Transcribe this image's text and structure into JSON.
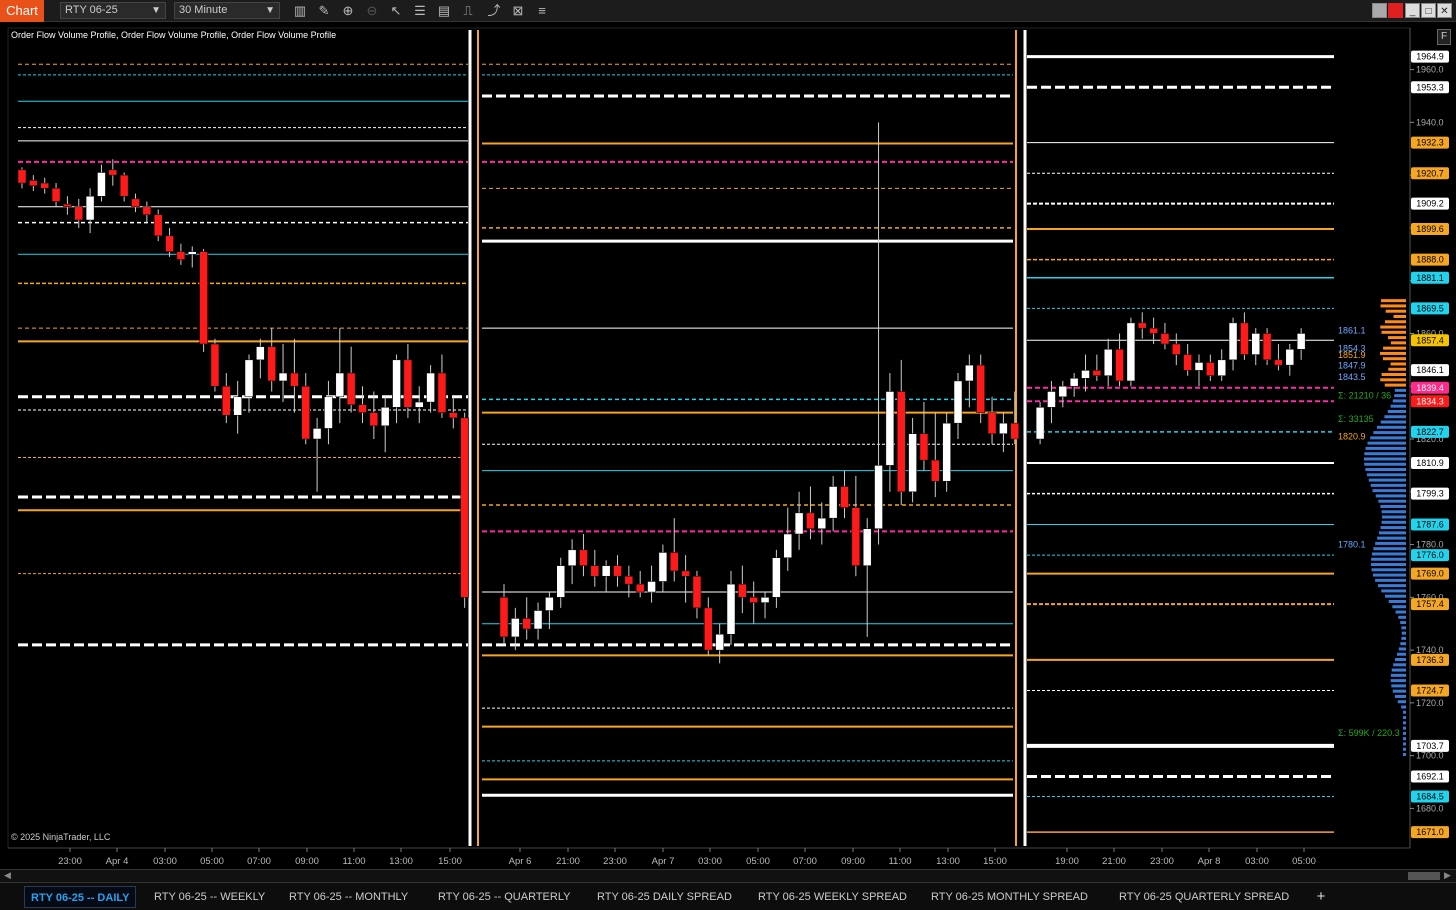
{
  "app": {
    "badge": "Chart",
    "instrument": "RTY 06-25",
    "timeframe": "30 Minute"
  },
  "toolbar_icons": [
    "bar-type-icon",
    "drawing-tool-icon",
    "zoom-in-icon",
    "zoom-out-icon",
    "pointer-icon",
    "properties-icon",
    "data-box-icon",
    "indicators-icon",
    "strategies-icon",
    "template-icon",
    "more-menu-icon"
  ],
  "window_buttons": [
    "link-window-icon",
    "color-link-icon",
    "minimize-icon",
    "maximize-icon",
    "close-icon"
  ],
  "indicator_label": "Order Flow Volume Profile, Order Flow Volume Profile, Order Flow Volume Profile",
  "copyright": "© 2025 NinjaTrader, LLC",
  "f_button": "F",
  "price_axis": {
    "min": 1665,
    "max": 1975,
    "ticks": [
      "1960.0",
      "1940.0",
      "1920.0",
      "1900.0",
      "1880.0",
      "1860.0",
      "1840.0",
      "1820.0",
      "1800.0",
      "1780.0",
      "1760.0",
      "1740.0",
      "1720.0",
      "1700.0",
      "1680.0"
    ],
    "level_labels": [
      {
        "text": "1964.9",
        "value": 1964.9,
        "color": "#ffffff"
      },
      {
        "text": "1953.3",
        "value": 1953.3,
        "color": "#ffffff"
      },
      {
        "text": "1932.3",
        "value": 1932.3,
        "color": "#f5a623"
      },
      {
        "text": "1920.7",
        "value": 1920.7,
        "color": "#f5a623"
      },
      {
        "text": "1909.2",
        "value": 1909.2,
        "color": "#ffffff"
      },
      {
        "text": "1899.6",
        "value": 1899.6,
        "color": "#f5a623"
      },
      {
        "text": "1888.0",
        "value": 1888.0,
        "color": "#f5a623"
      },
      {
        "text": "1881.1",
        "value": 1881.1,
        "color": "#22d3ee"
      },
      {
        "text": "1869.5",
        "value": 1869.5,
        "color": "#22d3ee"
      },
      {
        "text": "1857.4",
        "value": 1857.4,
        "color": "#f5c400"
      },
      {
        "text": "1846.1",
        "value": 1846.1,
        "color": "#ffffff"
      },
      {
        "text": "1839.4",
        "value": 1839.4,
        "color": "#ff2a8a"
      },
      {
        "text": "1834.3",
        "value": 1834.3,
        "color": "#ff1a1a"
      },
      {
        "text": "1822.7",
        "value": 1822.7,
        "color": "#22d3ee"
      },
      {
        "text": "1810.9",
        "value": 1810.9,
        "color": "#ffffff"
      },
      {
        "text": "1799.3",
        "value": 1799.3,
        "color": "#ffffff"
      },
      {
        "text": "1787.6",
        "value": 1787.6,
        "color": "#22d3ee"
      },
      {
        "text": "1776.0",
        "value": 1776.0,
        "color": "#22d3ee"
      },
      {
        "text": "1769.0",
        "value": 1769.0,
        "color": "#f5a623"
      },
      {
        "text": "1757.4",
        "value": 1757.4,
        "color": "#f5a623"
      },
      {
        "text": "1736.3",
        "value": 1736.3,
        "color": "#f5a623"
      },
      {
        "text": "1724.7",
        "value": 1724.7,
        "color": "#f5a623"
      },
      {
        "text": "1703.7",
        "value": 1703.7,
        "color": "#ffffff"
      },
      {
        "text": "1692.1",
        "value": 1692.1,
        "color": "#ffffff"
      },
      {
        "text": "1684.5",
        "value": 1684.5,
        "color": "#22d3ee"
      },
      {
        "text": "1671.0",
        "value": 1671.0,
        "color": "#f5a623"
      }
    ]
  },
  "profile_labels": [
    {
      "text": "1861.1",
      "value": 1861.1,
      "color": "#6fa8ff"
    },
    {
      "text": "1854.3",
      "value": 1854.3,
      "color": "#6fa8ff"
    },
    {
      "text": "1851.9",
      "value": 1851.9,
      "color": "#f5a623"
    },
    {
      "text": "1847.9",
      "value": 1847.9,
      "color": "#6fa8ff"
    },
    {
      "text": "1843.5",
      "value": 1843.5,
      "color": "#6fa8ff"
    },
    {
      "text": "Σ: 21210 / 36",
      "value": 1836.5,
      "color": "#22aa22"
    },
    {
      "text": "Σ: 33135",
      "value": 1827.5,
      "color": "#22aa22"
    },
    {
      "text": "1820.9",
      "value": 1820.9,
      "color": "#f5a623"
    },
    {
      "text": "1780.1",
      "value": 1780.1,
      "color": "#6fa8ff"
    },
    {
      "text": "Σ: 599K / 220.3",
      "value": 1708.5,
      "color": "#22aa22"
    }
  ],
  "time_axis": [
    "23:00",
    "Apr 4",
    "03:00",
    "05:00",
    "07:00",
    "09:00",
    "11:00",
    "13:00",
    "15:00",
    "Apr 6",
    "21:00",
    "23:00",
    "Apr 7",
    "03:00",
    "05:00",
    "07:00",
    "09:00",
    "11:00",
    "13:00",
    "15:00",
    "19:00",
    "21:00",
    "23:00",
    "Apr 8",
    "03:00",
    "05:00"
  ],
  "tabs": [
    {
      "label": "RTY 06-25 -- DAILY",
      "active": true
    },
    {
      "label": "RTY 06-25 -- WEEKLY",
      "active": false
    },
    {
      "label": "RTY 06-25 -- MONTHLY",
      "active": false
    },
    {
      "label": "RTY 06-25 -- QUARTERLY",
      "active": false
    },
    {
      "label": "RTY 06-25 DAILY SPREAD",
      "active": false
    },
    {
      "label": "RTY 06-25 WEEKLY SPREAD",
      "active": false
    },
    {
      "label": "RTY 06-25 MONTHLY SPREAD",
      "active": false
    },
    {
      "label": "RTY 06-25 QUARTERLY SPREAD",
      "active": false
    }
  ],
  "add_tab": "+",
  "colors": {
    "up": "#ffffff",
    "down": "#ff1a1a",
    "orange": "#f5a623",
    "cyan": "#22d3ee",
    "magenta": "#ff2aa8",
    "white": "#ffffff",
    "profile_blue": "#3a7bd5",
    "profile_orange": "#ff8c1a"
  },
  "chart_data": {
    "type": "candlestick",
    "instrument": "RTY 06-25",
    "timeframe": "30 Minute",
    "ylim": [
      1665,
      1975
    ],
    "candles": [
      [
        1922,
        1923,
        1915,
        1917
      ],
      [
        1918,
        1920,
        1914,
        1916
      ],
      [
        1917,
        1919,
        1913,
        1915
      ],
      [
        1915,
        1917,
        1908,
        1910
      ],
      [
        1909,
        1912,
        1905,
        1908
      ],
      [
        1908,
        1911,
        1900,
        1903
      ],
      [
        1903,
        1915,
        1898,
        1912
      ],
      [
        1912,
        1924,
        1910,
        1921
      ],
      [
        1922,
        1926,
        1916,
        1920
      ],
      [
        1920,
        1921,
        1910,
        1912
      ],
      [
        1911,
        1913,
        1906,
        1908
      ],
      [
        1908,
        1910,
        1902,
        1905
      ],
      [
        1905,
        1907,
        1895,
        1897
      ],
      [
        1897,
        1900,
        1889,
        1891
      ],
      [
        1891,
        1894,
        1886,
        1888
      ],
      [
        1890,
        1893,
        1885,
        1891
      ],
      [
        1891,
        1892,
        1853,
        1856
      ],
      [
        1856,
        1858,
        1838,
        1840
      ],
      [
        1840,
        1845,
        1826,
        1829
      ],
      [
        1829,
        1842,
        1822,
        1836
      ],
      [
        1836,
        1852,
        1830,
        1850
      ],
      [
        1850,
        1858,
        1843,
        1855
      ],
      [
        1855,
        1862,
        1838,
        1842
      ],
      [
        1842,
        1856,
        1834,
        1845
      ],
      [
        1845,
        1858,
        1830,
        1840
      ],
      [
        1840,
        1845,
        1818,
        1820
      ],
      [
        1820,
        1828,
        1800,
        1824
      ],
      [
        1824,
        1842,
        1818,
        1836
      ],
      [
        1836,
        1862,
        1826,
        1845
      ],
      [
        1845,
        1855,
        1830,
        1833
      ],
      [
        1833,
        1840,
        1826,
        1830
      ],
      [
        1830,
        1838,
        1820,
        1825
      ],
      [
        1825,
        1836,
        1815,
        1832
      ],
      [
        1832,
        1852,
        1826,
        1850
      ],
      [
        1850,
        1856,
        1828,
        1832
      ],
      [
        1832,
        1840,
        1826,
        1834
      ],
      [
        1834,
        1848,
        1830,
        1845
      ],
      [
        1845,
        1852,
        1828,
        1830
      ],
      [
        1830,
        1836,
        1824,
        1828
      ],
      [
        1828,
        1830,
        1756,
        1760
      ],
      [
        1760,
        1765,
        1742,
        1745
      ],
      [
        1745,
        1756,
        1740,
        1752
      ],
      [
        1752,
        1760,
        1744,
        1748
      ],
      [
        1748,
        1758,
        1744,
        1755
      ],
      [
        1755,
        1762,
        1748,
        1760
      ],
      [
        1760,
        1775,
        1756,
        1772
      ],
      [
        1772,
        1782,
        1765,
        1778
      ],
      [
        1778,
        1784,
        1768,
        1772
      ],
      [
        1772,
        1778,
        1764,
        1768
      ],
      [
        1768,
        1774,
        1762,
        1772
      ],
      [
        1772,
        1776,
        1764,
        1768
      ],
      [
        1768,
        1772,
        1760,
        1765
      ],
      [
        1765,
        1770,
        1760,
        1762
      ],
      [
        1762,
        1772,
        1758,
        1766
      ],
      [
        1766,
        1780,
        1762,
        1777
      ],
      [
        1777,
        1790,
        1766,
        1770
      ],
      [
        1770,
        1776,
        1758,
        1768
      ],
      [
        1768,
        1770,
        1752,
        1756
      ],
      [
        1756,
        1760,
        1738,
        1740
      ],
      [
        1740,
        1750,
        1735,
        1746
      ],
      [
        1746,
        1770,
        1742,
        1765
      ],
      [
        1765,
        1772,
        1754,
        1760
      ],
      [
        1760,
        1766,
        1750,
        1758
      ],
      [
        1758,
        1762,
        1752,
        1760
      ],
      [
        1760,
        1778,
        1756,
        1775
      ],
      [
        1775,
        1794,
        1770,
        1784
      ],
      [
        1784,
        1800,
        1778,
        1792
      ],
      [
        1792,
        1802,
        1782,
        1786
      ],
      [
        1786,
        1796,
        1780,
        1790
      ],
      [
        1790,
        1806,
        1785,
        1802
      ],
      [
        1802,
        1808,
        1790,
        1794
      ],
      [
        1794,
        1806,
        1768,
        1772
      ],
      [
        1772,
        1790,
        1745,
        1786
      ],
      [
        1786,
        1940,
        1780,
        1810
      ],
      [
        1810,
        1845,
        1800,
        1838
      ],
      [
        1838,
        1850,
        1795,
        1800
      ],
      [
        1800,
        1828,
        1796,
        1822
      ],
      [
        1822,
        1834,
        1808,
        1812
      ],
      [
        1812,
        1830,
        1798,
        1804
      ],
      [
        1804,
        1830,
        1800,
        1826
      ],
      [
        1826,
        1845,
        1820,
        1842
      ],
      [
        1842,
        1852,
        1832,
        1848
      ],
      [
        1848,
        1852,
        1826,
        1830
      ],
      [
        1830,
        1836,
        1818,
        1822
      ],
      [
        1822,
        1830,
        1815,
        1826
      ],
      [
        1826,
        1838,
        1818,
        1820
      ],
      [
        1820,
        1834,
        1818,
        1832
      ],
      [
        1832,
        1842,
        1826,
        1838
      ],
      [
        1836,
        1842,
        1832,
        1840
      ],
      [
        1840,
        1845,
        1836,
        1843
      ],
      [
        1843,
        1852,
        1838,
        1846
      ],
      [
        1846,
        1852,
        1842,
        1844
      ],
      [
        1844,
        1858,
        1840,
        1854
      ],
      [
        1854,
        1860,
        1840,
        1842
      ],
      [
        1842,
        1866,
        1840,
        1864
      ],
      [
        1864,
        1868,
        1858,
        1862
      ],
      [
        1862,
        1866,
        1856,
        1860
      ],
      [
        1860,
        1864,
        1854,
        1856
      ],
      [
        1856,
        1860,
        1848,
        1852
      ],
      [
        1852,
        1856,
        1844,
        1846
      ],
      [
        1846,
        1852,
        1840,
        1849
      ],
      [
        1849,
        1852,
        1842,
        1844
      ],
      [
        1844,
        1854,
        1842,
        1850
      ],
      [
        1850,
        1866,
        1846,
        1864
      ],
      [
        1864,
        1868,
        1850,
        1852
      ],
      [
        1852,
        1862,
        1848,
        1860
      ],
      [
        1860,
        1862,
        1848,
        1850
      ],
      [
        1850,
        1856,
        1846,
        1848
      ],
      [
        1848,
        1856,
        1844,
        1854
      ],
      [
        1854,
        1862,
        1850,
        1860
      ]
    ]
  }
}
